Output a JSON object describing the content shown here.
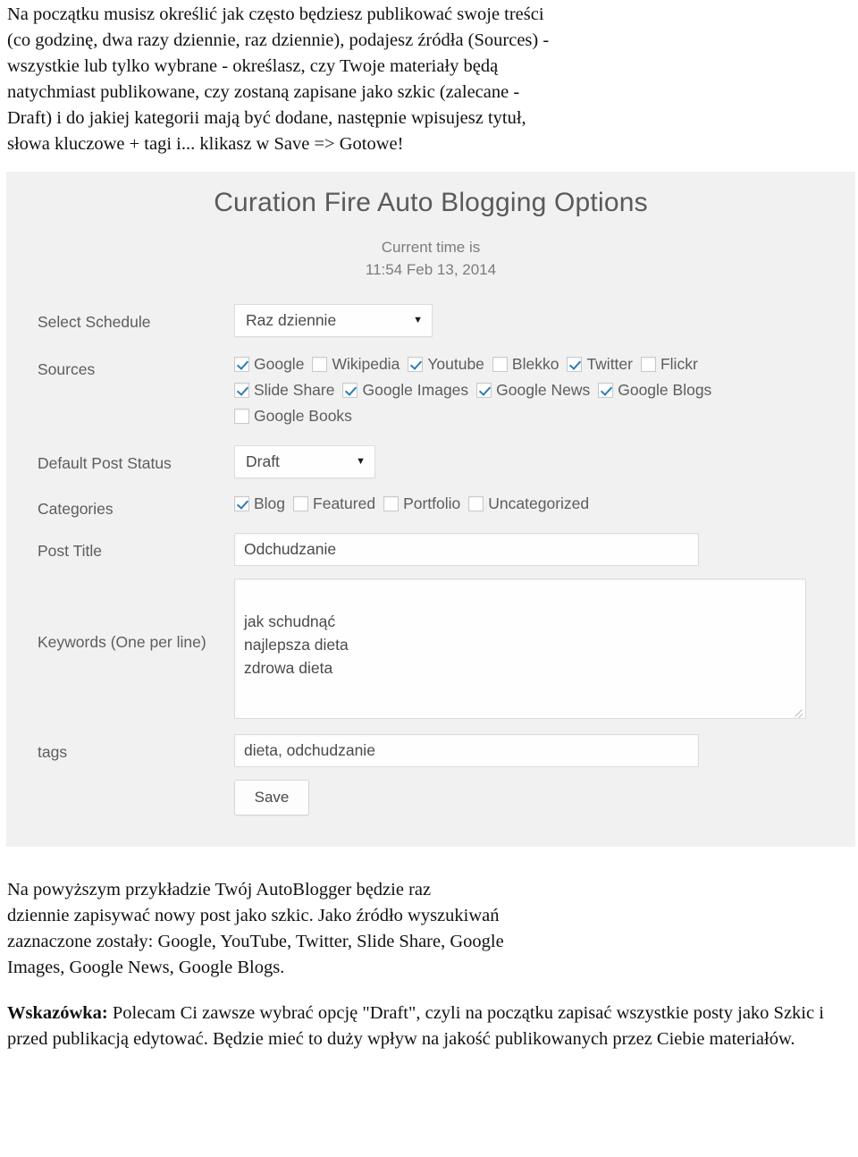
{
  "intro": {
    "lines": [
      "Na początku musisz określić jak często będziesz publikować swoje treści",
      "(co godzinę, dwa razy dziennie, raz dziennie), podajesz źródła (Sources) -",
      "wszystkie lub tylko wybrane - określasz, czy Twoje materiały będą",
      "natychmiast publikowane, czy zostaną zapisane jako szkic (zalecane -",
      "Draft) i do jakiej kategorii mają być dodane, następnie wpisujesz tytuł,",
      "słowa kluczowe + tagi i... klikasz w Save => Gotowe!"
    ]
  },
  "screenshot": {
    "title": "Curation Fire Auto Blogging Options",
    "time_label": "Current time is",
    "time_value": "11:54 Feb 13, 2014",
    "accent_check_color": "#2b7cb5",
    "panel_bg": "#f1f1f1",
    "fields": {
      "schedule": {
        "label": "Select Schedule",
        "value": "Raz dziennie",
        "caret": "▼"
      },
      "sources": {
        "label": "Sources",
        "items": [
          {
            "label": "Google",
            "checked": true
          },
          {
            "label": "Wikipedia",
            "checked": false
          },
          {
            "label": "Youtube",
            "checked": true
          },
          {
            "label": "Blekko",
            "checked": false
          },
          {
            "label": "Twitter",
            "checked": true
          },
          {
            "label": "Flickr",
            "checked": false
          },
          {
            "label": "Slide Share",
            "checked": true
          },
          {
            "label": "Google Images",
            "checked": true
          },
          {
            "label": "Google News",
            "checked": true
          },
          {
            "label": "Google Blogs",
            "checked": true
          },
          {
            "label": "Google Books",
            "checked": false
          }
        ]
      },
      "post_status": {
        "label": "Default Post Status",
        "value": "Draft",
        "caret": "▼"
      },
      "categories": {
        "label": "Categories",
        "items": [
          {
            "label": "Blog",
            "checked": true
          },
          {
            "label": "Featured",
            "checked": false
          },
          {
            "label": "Portfolio",
            "checked": false
          },
          {
            "label": "Uncategorized",
            "checked": false
          }
        ]
      },
      "post_title": {
        "label": "Post Title",
        "value": "Odchudzanie"
      },
      "keywords": {
        "label": "Keywords (One per line)",
        "value": "jak schudnąć\nnajlepsza dieta\nzdrowa dieta"
      },
      "tags": {
        "label": "tags",
        "value": "dieta, odchudzanie"
      },
      "save": {
        "label": "Save"
      }
    }
  },
  "outro": {
    "paragraph1": [
      "Na powyższym przykładzie Twój AutoBlogger będzie raz",
      "dziennie zapisywać nowy post jako szkic. Jako źródło wyszukiwań",
      "zaznaczone zostały: Google, YouTube, Twitter, Slide Share, Google",
      "Images, Google News, Google Blogs."
    ],
    "tip_lead": "Wskazówka:",
    "tip_rest": " Polecam Ci zawsze wybrać opcję \"Draft\", czyli na początku zapisać wszystkie posty jako Szkic i przed publikacją edytować. Będzie mieć to duży wpływ na jakość publikowanych przez Ciebie materiałów."
  }
}
